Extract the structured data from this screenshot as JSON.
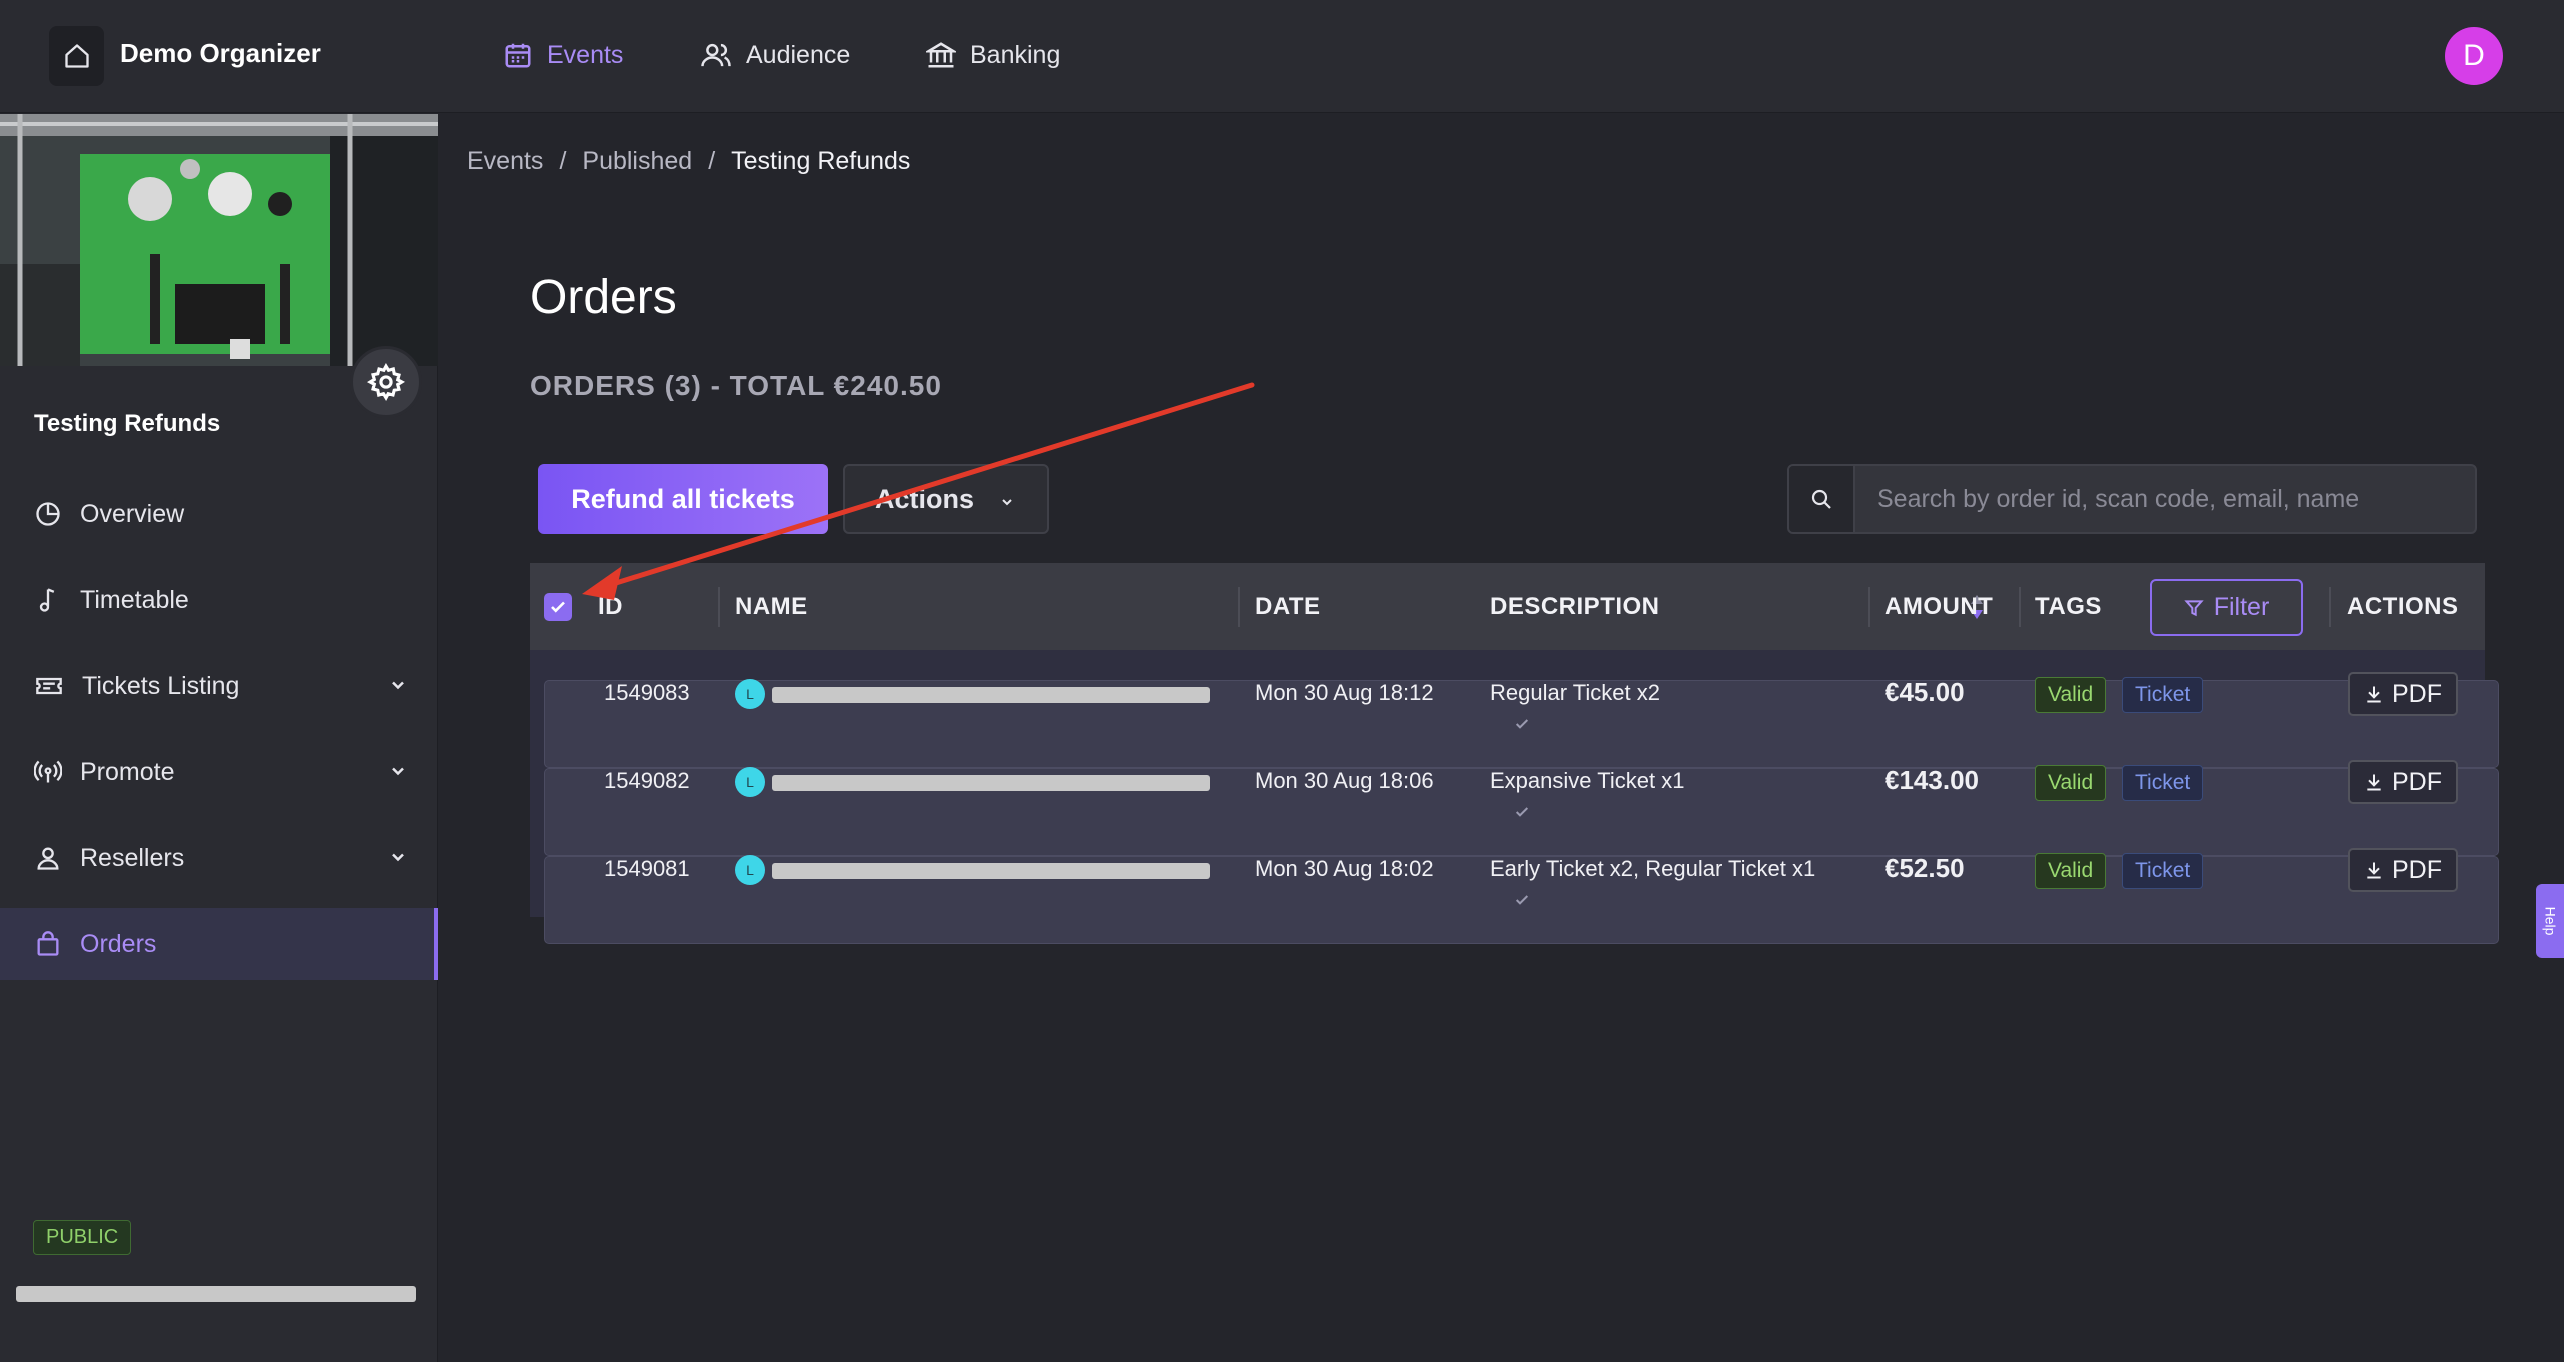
{
  "org": {
    "name": "Demo Organizer"
  },
  "nav": {
    "events": "Events",
    "audience": "Audience",
    "banking": "Banking"
  },
  "user": {
    "initial": "D"
  },
  "sidebar": {
    "event_name": "Testing Refunds",
    "items": [
      {
        "label": "Overview"
      },
      {
        "label": "Timetable"
      },
      {
        "label": "Tickets Listing"
      },
      {
        "label": "Promote"
      },
      {
        "label": "Resellers"
      },
      {
        "label": "Orders"
      }
    ],
    "public_badge": "PUBLIC"
  },
  "breadcrumb": {
    "events": "Events",
    "sep1": "/",
    "published": "Published",
    "sep2": "/",
    "current": "Testing Refunds"
  },
  "page": {
    "title": "Orders",
    "summary": "ORDERS (3) - TOTAL €240.50"
  },
  "toolbar": {
    "refund_all": "Refund all tickets",
    "actions": "Actions",
    "search_placeholder": "Search by order id, scan code, email, name"
  },
  "table": {
    "headers": {
      "id": "ID",
      "name": "NAME",
      "date": "DATE",
      "description": "DESCRIPTION",
      "amount": "AMOUNT",
      "tags": "TAGS",
      "filter": "Filter",
      "actions": "ACTIONS"
    },
    "rows": [
      {
        "id": "1549083",
        "avatar": "L",
        "date": "Mon 30 Aug 18:12",
        "description": "Regular Ticket x2",
        "amount": "€45.00",
        "tag1": "Valid",
        "tag2": "Ticket",
        "action": "PDF"
      },
      {
        "id": "1549082",
        "avatar": "L",
        "date": "Mon 30 Aug 18:06",
        "description": "Expansive Ticket x1",
        "amount": "€143.00",
        "tag1": "Valid",
        "tag2": "Ticket",
        "action": "PDF"
      },
      {
        "id": "1549081",
        "avatar": "L",
        "date": "Mon 30 Aug 18:02",
        "description": "Early Ticket x2, Regular Ticket x1",
        "amount": "€52.50",
        "tag1": "Valid",
        "tag2": "Ticket",
        "action": "PDF"
      }
    ]
  },
  "help": {
    "label": "Help"
  },
  "colors": {
    "accent": "#8b6cf0",
    "accent_text": "#a98cf5",
    "background": "#24252b",
    "panel": "#2a2b31",
    "valid": "#9ad870",
    "ticket": "#7e96ea",
    "annotation": "#e23a2a"
  }
}
